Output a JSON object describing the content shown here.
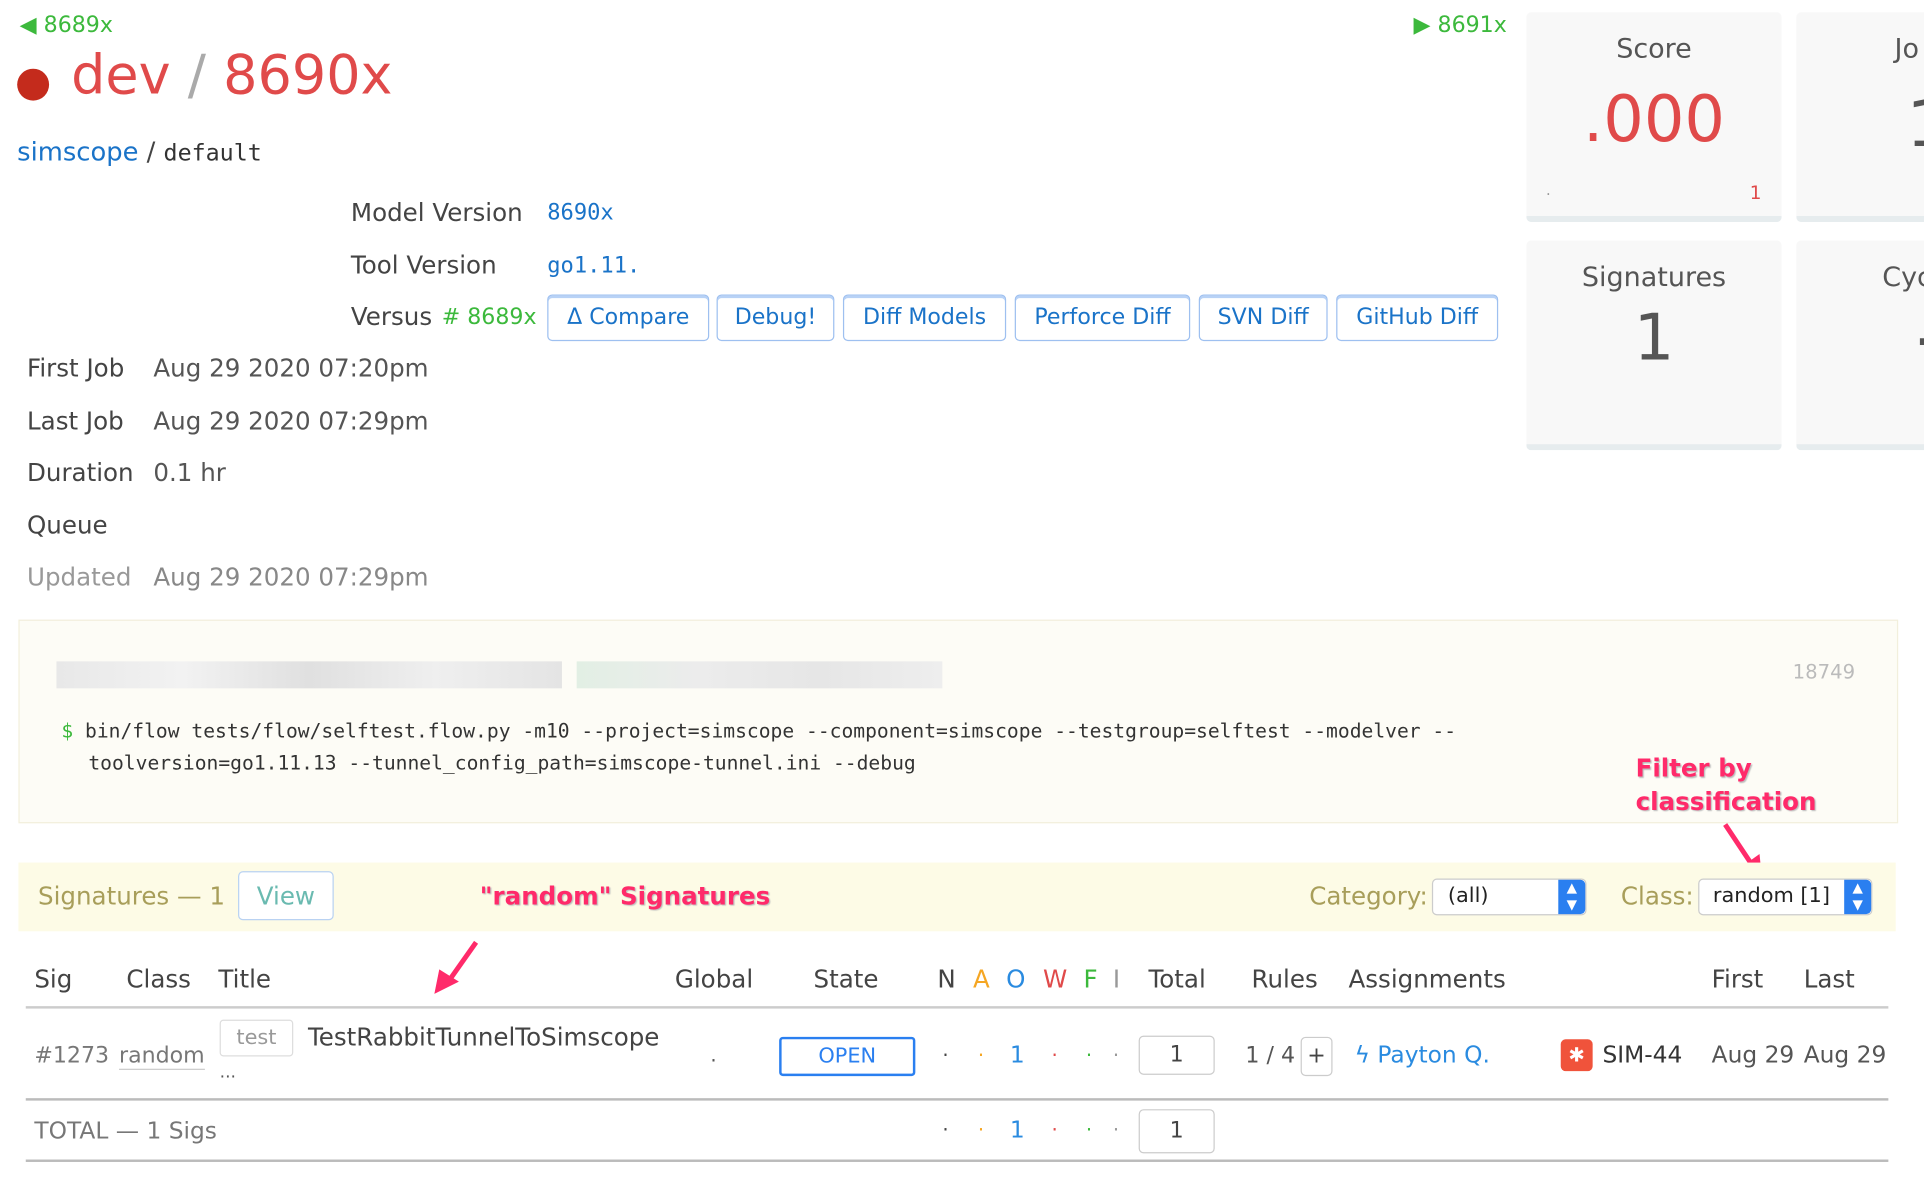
{
  "nav": {
    "prev": "8689x",
    "next": "8691x"
  },
  "header": {
    "status_color": "#c42b1c",
    "branch": "dev",
    "separator": "/",
    "build": "8690x"
  },
  "breadcrumb": {
    "project": "simscope",
    "sep": "/",
    "variant": "default"
  },
  "info": {
    "model_version_label": "Model Version",
    "model_version": "8690x",
    "tool_version_label": "Tool Version",
    "tool_version": "go1.11.",
    "versus_label": "Versus",
    "versus_value": "# 8689x",
    "buttons": [
      "Δ Compare",
      "Debug!",
      "Diff Models",
      "Perforce Diff",
      "SVN Diff",
      "GitHub Diff"
    ],
    "first_job_label": "First Job",
    "first_job": "Aug 29 2020 07:20pm",
    "last_job_label": "Last Job",
    "last_job": "Aug 29 2020 07:29pm",
    "duration_label": "Duration",
    "duration": "0.1 hr",
    "queue_label": "Queue",
    "updated_label": "Updated",
    "updated": "Aug 29 2020 07:29pm"
  },
  "cards": {
    "score_title": "Score",
    "score_value": ".000",
    "score_left": ".",
    "score_right": "1",
    "jobs_title": "Jo",
    "jobs_value": "1",
    "sigs_title": "Signatures",
    "sigs_value": "1",
    "cycles_title": "Cyc",
    "cycles_value": "·"
  },
  "command": {
    "id": "18749",
    "prompt": "$",
    "line1": "bin/flow tests/flow/selftest.flow.py -m10 --project=simscope --component=simscope --testgroup=selftest --modelver --",
    "line2": "toolversion=go1.11.13 --tunnel_config_path=simscope-tunnel.ini --debug"
  },
  "annotations": {
    "filter": "Filter by",
    "filter2": "classification",
    "random": "\"random\" Signatures"
  },
  "sigbar": {
    "title": "Signatures — 1",
    "view": "View",
    "category_label": "Category:",
    "category_value": "(all)",
    "class_label": "Class:",
    "class_value": "random [1]"
  },
  "table": {
    "headers": {
      "sig": "Sig",
      "class": "Class",
      "title": "Title",
      "global": "Global",
      "state": "State",
      "n": "N",
      "a": "A",
      "o": "O",
      "w": "W",
      "f": "F",
      "i": "I",
      "total": "Total",
      "rules": "Rules",
      "assignments": "Assignments",
      "first": "First",
      "last": "Last"
    },
    "row": {
      "sig": "#1273",
      "class": "random",
      "tag": "test",
      "title": "TestRabbitTunnelToSimscope",
      "more": "...",
      "global": ".",
      "state": "OPEN",
      "n": "·",
      "a": "·",
      "o": "1",
      "w": "·",
      "f": "·",
      "i": "·",
      "total": "1",
      "rules": "1 / 4",
      "rules_add": "+",
      "assignee": "Payton Q.",
      "ticket": "SIM-44",
      "first": "Aug 29",
      "last": "Aug 29"
    },
    "total": {
      "label": "TOTAL — 1 Sigs",
      "n": "·",
      "a": "·",
      "o": "1",
      "w": "·",
      "f": "·",
      "i": "·",
      "total": "1"
    }
  },
  "colors": {
    "n": "#444444",
    "a": "#f5a623",
    "o": "#2a8be0",
    "w": "#e04a4a",
    "f": "#3cb93c",
    "i": "#999999"
  }
}
